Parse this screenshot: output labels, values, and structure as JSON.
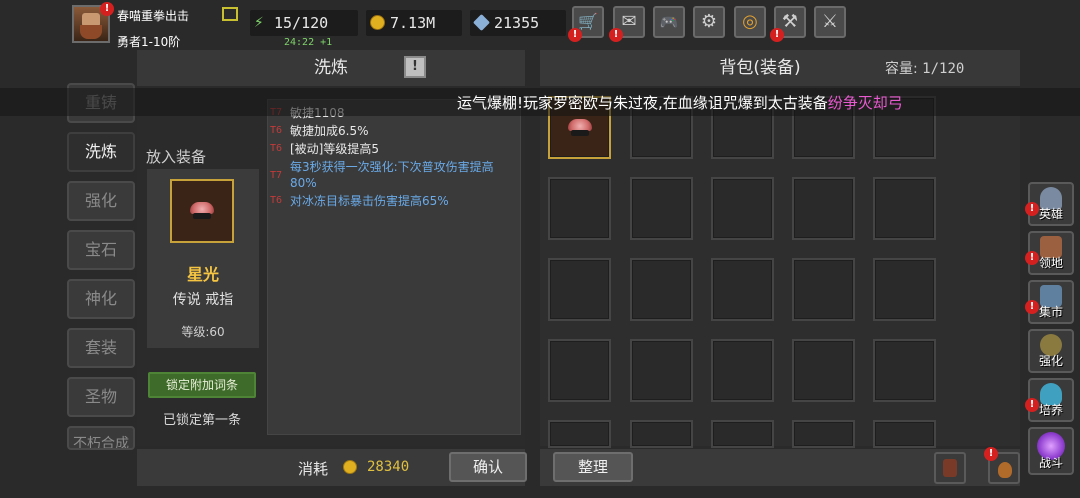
{
  "player": {
    "name": "春喵重拳出击",
    "rank": "勇者1-10阶",
    "badge": "!"
  },
  "stats": {
    "stamina": "15/120",
    "gold": "7.13M",
    "gems": "21355",
    "timer": "24:22 +1"
  },
  "top_buttons": [
    {
      "icon": "cart-icon",
      "glyph": "🛒",
      "badge": "!"
    },
    {
      "icon": "mail-icon",
      "glyph": "✉",
      "badge": "!"
    },
    {
      "icon": "gamepad-icon",
      "glyph": "🎮",
      "badge": ""
    },
    {
      "icon": "gear-icon",
      "glyph": "⚙",
      "badge": ""
    },
    {
      "icon": "palette-icon",
      "glyph": "◎",
      "badge": ""
    },
    {
      "icon": "broom-icon",
      "glyph": "⚒",
      "badge": "!"
    },
    {
      "icon": "swords-icon",
      "glyph": "⚔",
      "badge": ""
    }
  ],
  "left_nav": [
    "重铸",
    "洗炼",
    "强化",
    "宝石",
    "神化",
    "套装",
    "圣物",
    "不朽合成"
  ],
  "wash": {
    "title": "洗炼",
    "help": "!",
    "place_label": "放入装备",
    "item_name": "星光",
    "item_type": "传说 戒指",
    "item_level": "等级:60",
    "lock_button": "锁定附加词条",
    "lock_status": "已锁定第一条",
    "affixes": [
      {
        "tier": "T7",
        "text": "敏捷1108",
        "blue": false
      },
      {
        "tier": "T6",
        "text": "敏捷加成6.5%",
        "blue": false
      },
      {
        "tier": "T6",
        "text": "[被动]等级提高5",
        "blue": false
      },
      {
        "tier": "T7",
        "text": "每3秒获得一次强化:下次普攻伤害提高80%",
        "blue": true
      },
      {
        "tier": "T6",
        "text": "对冰冻目标暴击伤害提高65%",
        "blue": true
      }
    ],
    "cost_label": "消耗",
    "cost_value": "28340",
    "confirm": "确认"
  },
  "bag": {
    "title": "背包(装备)",
    "capacity_label": "容量:",
    "capacity_value": "1/120",
    "sort": "整理"
  },
  "marquee": {
    "text": "运气爆棚!玩家罗密欧与朱过夜,在血缘诅咒爆到太古装备",
    "highlight": "纷争灭却弓"
  },
  "side_menu": [
    {
      "label": "英雄",
      "icon": "helmet-icon",
      "color": "#7a8aa0"
    },
    {
      "label": "领地",
      "icon": "castle-icon",
      "color": "#9a6040"
    },
    {
      "label": "集市",
      "icon": "market-icon",
      "color": "#6080a0"
    },
    {
      "label": "强化",
      "icon": "anvil-icon",
      "color": "#8a7a40"
    },
    {
      "label": "培养",
      "icon": "potion-icon",
      "color": "#40a0c0"
    },
    {
      "label": "战斗",
      "icon": "portal-icon",
      "color": "#9040d0"
    }
  ]
}
